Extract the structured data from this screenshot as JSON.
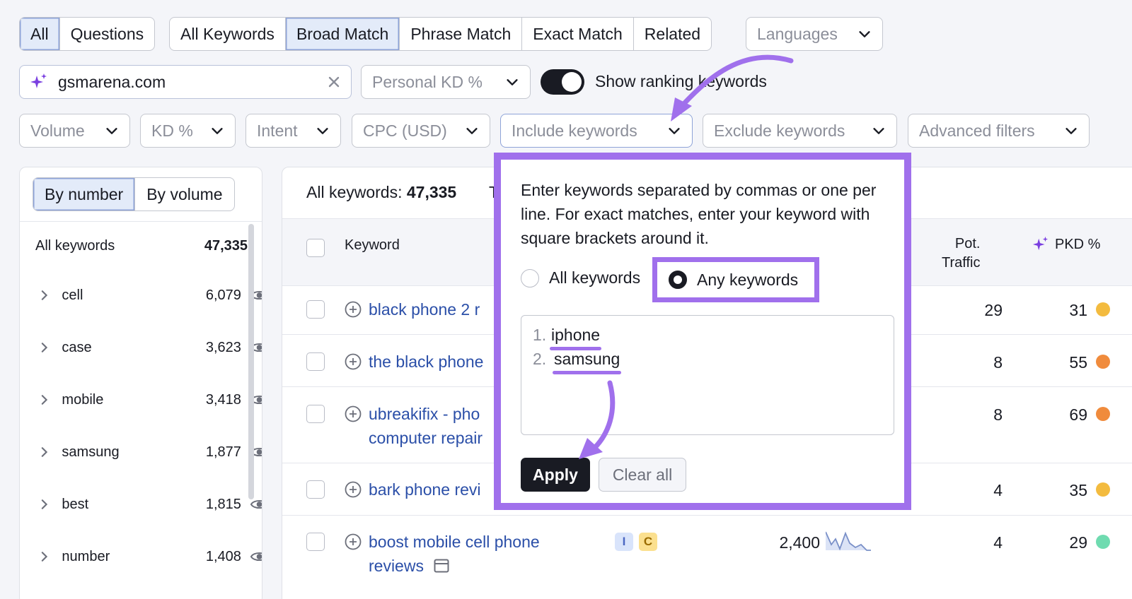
{
  "colors": {
    "accent": "#a070ec",
    "link": "#2b4fa8",
    "dark": "#191b23"
  },
  "tabs_group1": [
    "All",
    "Questions"
  ],
  "tabs_group2": [
    "All Keywords",
    "Broad Match",
    "Phrase Match",
    "Exact Match",
    "Related"
  ],
  "languages_label": "Languages",
  "search": {
    "value": "gsmarena.com",
    "icon": "sparkle-icon"
  },
  "personal_kd_label": "Personal KD %",
  "toggle_label": "Show ranking keywords",
  "filters": {
    "volume": "Volume",
    "kd": "KD %",
    "intent": "Intent",
    "cpc": "CPC (USD)",
    "include": "Include keywords",
    "exclude": "Exclude keywords",
    "advanced": "Advanced filters"
  },
  "left_panel": {
    "by_number": "By number",
    "by_volume": "By volume",
    "all_label": "All keywords",
    "all_count": "47,335",
    "groups": [
      {
        "name": "cell",
        "count": "6,079"
      },
      {
        "name": "case",
        "count": "3,623"
      },
      {
        "name": "mobile",
        "count": "3,418"
      },
      {
        "name": "samsung",
        "count": "1,877"
      },
      {
        "name": "best",
        "count": "1,815"
      },
      {
        "name": "number",
        "count": "1,408"
      }
    ]
  },
  "main": {
    "all_keywords_label": "All keywords:",
    "all_keywords_count": "47,335",
    "truncated": "T",
    "col_keyword": "Keyword",
    "col_pot_traffic_1": "Pot.",
    "col_pot_traffic_2": "Traffic",
    "col_pkd": "PKD %",
    "rows": [
      {
        "keyword": "black phone 2 r",
        "pot": "29",
        "pkd": "31",
        "dot": "#f3bb3f"
      },
      {
        "keyword": "the black phone",
        "pot": "8",
        "pkd": "55",
        "dot": "#f08b3c"
      },
      {
        "keyword": "ubreakifix - pho",
        "keyword2": "computer repair",
        "pot": "8",
        "pkd": "69",
        "dot": "#f08b3c"
      },
      {
        "keyword": "bark phone revi",
        "pot": "4",
        "pkd": "35",
        "dot": "#f3bb3f"
      },
      {
        "keyword": "boost mobile cell phone",
        "keyword2": "reviews",
        "badge_i": "I",
        "badge_c": "C",
        "volume": "2,400",
        "pot": "4",
        "pkd": "29",
        "dot": "#6fdbb0"
      }
    ]
  },
  "popover": {
    "instructions": "Enter keywords separated by commas or one per line. For exact matches, enter your keyword with square brackets around it.",
    "radio_all": "All keywords",
    "radio_any": "Any keywords",
    "lines": [
      {
        "n": "1.",
        "value": "iphone"
      },
      {
        "n": "2.",
        "value": "samsung"
      }
    ],
    "apply": "Apply",
    "clear": "Clear all"
  }
}
